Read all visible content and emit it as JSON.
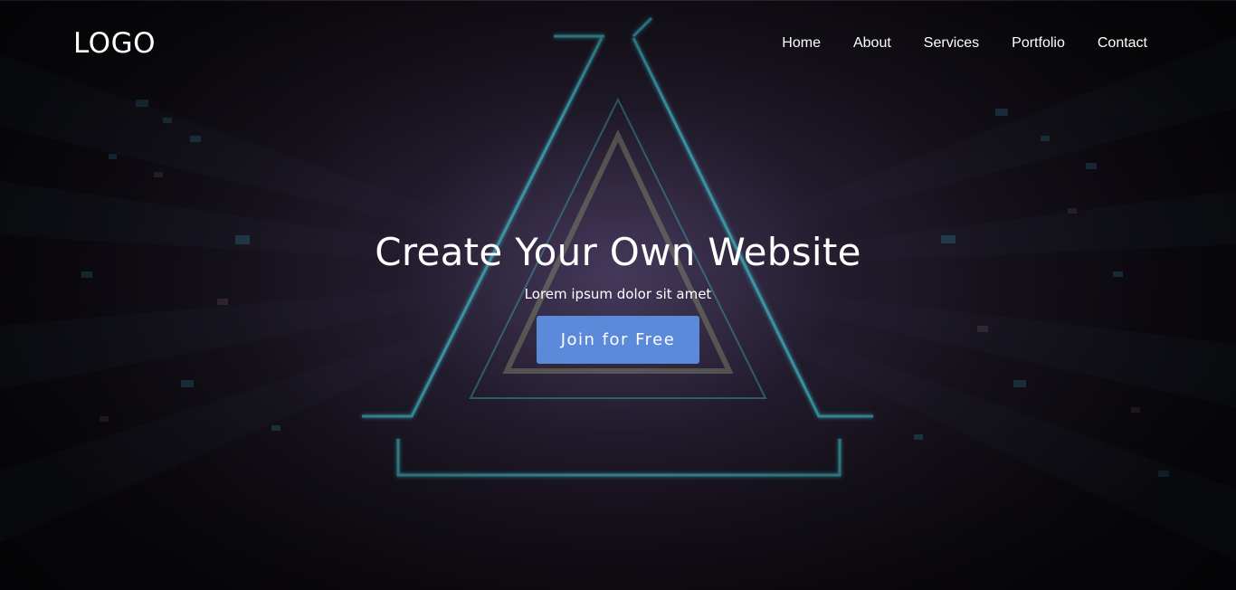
{
  "header": {
    "logo": "LOGO",
    "nav": [
      {
        "label": "Home"
      },
      {
        "label": "About"
      },
      {
        "label": "Services"
      },
      {
        "label": "Portfolio"
      },
      {
        "label": "Contact"
      }
    ]
  },
  "hero": {
    "title": "Create Your Own Website",
    "subtitle": "Lorem ipsum dolor sit amet",
    "cta_label": "Join for Free"
  },
  "colors": {
    "cta_background": "#5b8ada",
    "text": "#ffffff",
    "background": "#16121c",
    "neon_accent": "#3fb8c4"
  }
}
